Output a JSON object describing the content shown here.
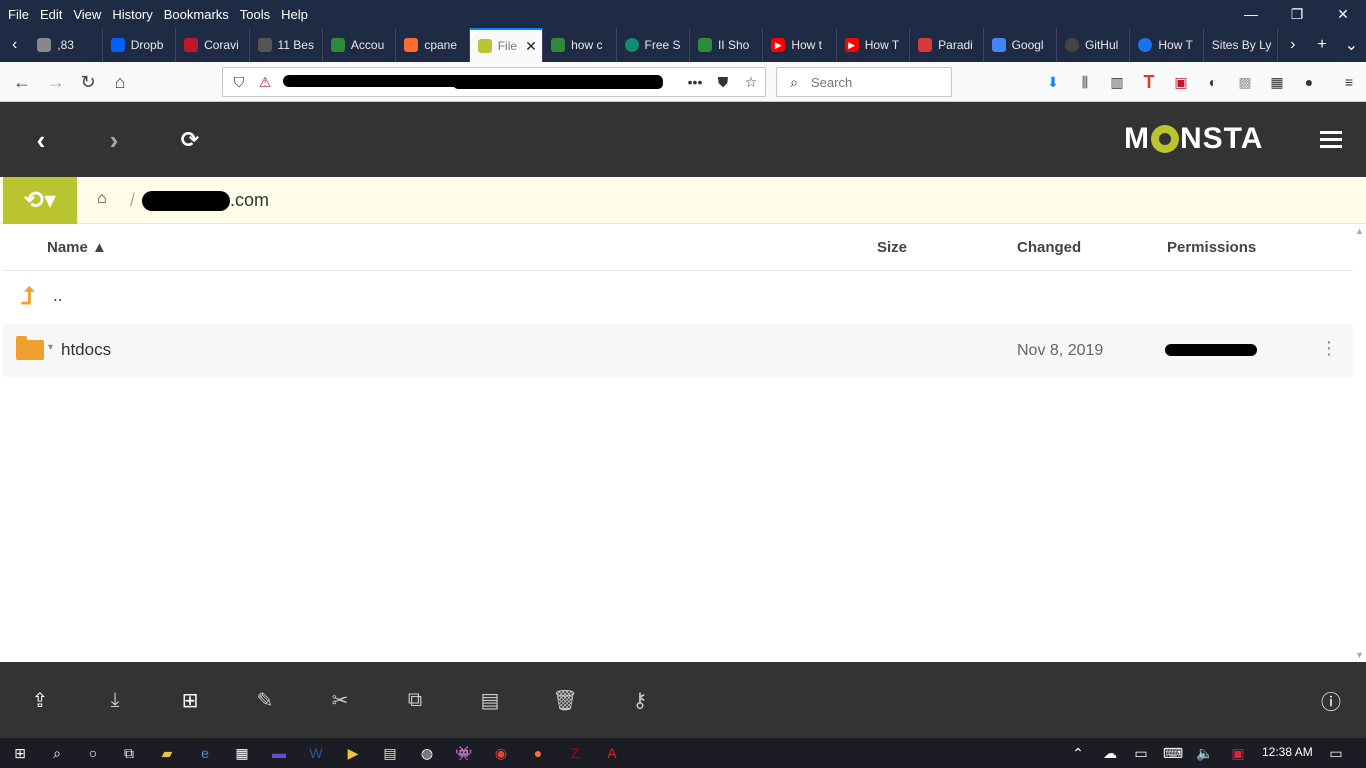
{
  "menu": [
    "File",
    "Edit",
    "View",
    "History",
    "Bookmarks",
    "Tools",
    "Help"
  ],
  "window_controls": [
    "—",
    "❐",
    "✕"
  ],
  "tabs": [
    {
      "label": ",83",
      "icon_color": "#888"
    },
    {
      "label": "Dropb",
      "icon_color": "#0061ff"
    },
    {
      "label": "Coravi",
      "icon_color": "#c0182a"
    },
    {
      "label": "11 Bes",
      "icon_color": "#555"
    },
    {
      "label": "Accou",
      "icon_color": "#2e8b3a"
    },
    {
      "label": "cpane",
      "icon_color": "#ff6c2c"
    },
    {
      "label": "File",
      "icon_color": "#b9c42e",
      "active": true
    },
    {
      "label": "how c",
      "icon_color": "#2e8b3a"
    },
    {
      "label": "Free S",
      "icon_color": "#138a72"
    },
    {
      "label": "II Sho",
      "icon_color": "#2e8b3a"
    },
    {
      "label": "How t",
      "icon_color": "#ff0000"
    },
    {
      "label": "How T",
      "icon_color": "#ff0000"
    },
    {
      "label": "Paradi",
      "icon_color": "#d43c3c"
    },
    {
      "label": "Googl",
      "icon_color": "#4285f4"
    },
    {
      "label": "GitHul",
      "icon_color": "#444"
    },
    {
      "label": "How T",
      "icon_color": "#1a73e8"
    },
    {
      "label": "Sites By Ly",
      "icon_color": "none"
    }
  ],
  "tab_close": "✕",
  "search": {
    "placeholder": "Search"
  },
  "brand": {
    "pre": "M",
    "post": "NSTA"
  },
  "breadcrumb": {
    "separator": "/",
    "domain_suffix": ".com"
  },
  "columns": {
    "name": "Name ▲",
    "size": "Size",
    "changed": "Changed",
    "permissions": "Permissions"
  },
  "rows": [
    {
      "name": ".."
    },
    {
      "name": "htdocs",
      "changed": "Nov 8, 2019"
    }
  ],
  "taskbar": {
    "time": "12:38 AM"
  },
  "colors": {
    "accent": "#b9c42e",
    "header": "#333333",
    "folder": "#f0a030",
    "firefox_chrome": "#1f2a44"
  },
  "icons": [
    "back-icon",
    "forward-icon",
    "refresh-icon",
    "menu-icon",
    "history-icon",
    "home-icon",
    "upload-icon",
    "download-icon",
    "new-item-icon",
    "edit-icon",
    "cut-icon",
    "copy-icon",
    "paste-icon",
    "delete-icon",
    "permissions-icon",
    "info-icon"
  ]
}
